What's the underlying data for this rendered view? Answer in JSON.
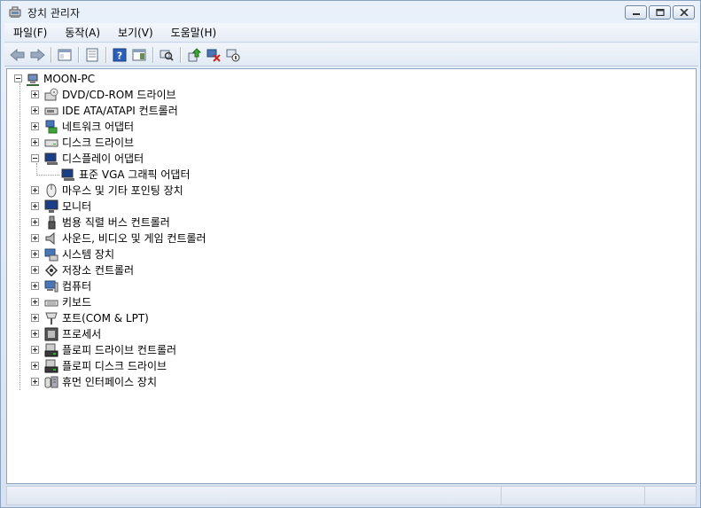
{
  "window": {
    "title": "장치 관리자"
  },
  "caption": {
    "minimize": "minimize-icon",
    "maximize": "maximize-icon",
    "close": "close-icon"
  },
  "menu": [
    {
      "label": "파일(F)"
    },
    {
      "label": "동작(A)"
    },
    {
      "label": "보기(V)"
    },
    {
      "label": "도움말(H)"
    }
  ],
  "toolbar": [
    "back-icon",
    "forward-icon",
    "show-hide-console-tree-icon",
    "properties-icon",
    "help-icon",
    "action-pane-icon",
    "scan-hardware-icon",
    "update-driver-icon",
    "uninstall-icon",
    "disable-icon"
  ],
  "tree": {
    "root": {
      "label": "MOON-PC",
      "icon": "computer-network-icon"
    },
    "items": [
      {
        "label": "DVD/CD-ROM 드라이브",
        "icon": "dvd-drive-icon"
      },
      {
        "label": "IDE ATA/ATAPI 컨트롤러",
        "icon": "ide-controller-icon"
      },
      {
        "label": "네트워크 어댑터",
        "icon": "network-adapter-icon"
      },
      {
        "label": "디스크 드라이브",
        "icon": "disk-drive-icon"
      },
      {
        "label": "디스플레이 어댑터",
        "icon": "display-adapter-icon",
        "expanded": true,
        "children": [
          {
            "label": "표준 VGA 그래픽 어댑터",
            "icon": "vga-adapter-icon"
          }
        ]
      },
      {
        "label": "마우스 및 기타 포인팅 장치",
        "icon": "mouse-icon"
      },
      {
        "label": "모니터",
        "icon": "monitor-icon"
      },
      {
        "label": "범용 직렬 버스 컨트롤러",
        "icon": "usb-controller-icon"
      },
      {
        "label": "사운드, 비디오 및 게임 컨트롤러",
        "icon": "sound-icon"
      },
      {
        "label": "시스템 장치",
        "icon": "system-devices-icon"
      },
      {
        "label": "저장소 컨트롤러",
        "icon": "storage-controller-icon"
      },
      {
        "label": "컴퓨터",
        "icon": "computer-icon"
      },
      {
        "label": "키보드",
        "icon": "keyboard-icon"
      },
      {
        "label": "포트(COM & LPT)",
        "icon": "port-icon"
      },
      {
        "label": "프로세서",
        "icon": "processor-icon"
      },
      {
        "label": "플로피 드라이브 컨트롤러",
        "icon": "floppy-controller-icon"
      },
      {
        "label": "플로피 디스크 드라이브",
        "icon": "floppy-drive-icon"
      },
      {
        "label": "휴먼 인터페이스 장치",
        "icon": "hid-icon"
      }
    ]
  }
}
